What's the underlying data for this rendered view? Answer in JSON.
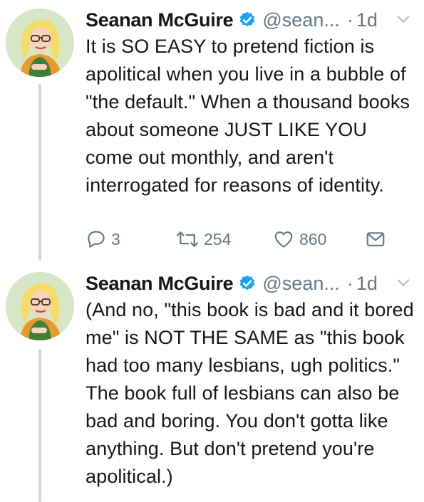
{
  "tweets": [
    {
      "author_name": "Seanan McGuire",
      "handle": "@sean...",
      "dot": "·",
      "time": "1d",
      "text": "It is SO EASY to pretend fiction is apolitical when you live in a bubble of \"the default.\" When a thousand books about someone JUST LIKE YOU come out monthly, and aren't interrogated for reasons of identity.",
      "replies": "3",
      "retweets": "254",
      "likes": "860"
    },
    {
      "author_name": "Seanan McGuire",
      "handle": "@sean...",
      "dot": "·",
      "time": "1d",
      "text": "(And no, \"this book is bad and it bored me\" is NOT THE SAME as \"this book had too many lesbians, ugh politics.\" The book full of lesbians can also be bad and boring. You don't gotta like anything. But don't pretend you're apolitical.)"
    }
  ],
  "icons": {
    "verified": "verified-badge-icon",
    "caret": "chevron-down-icon",
    "reply": "reply-icon",
    "retweet": "retweet-icon",
    "like": "heart-icon",
    "dm": "envelope-icon"
  },
  "colors": {
    "verified_blue": "#1da1f2",
    "secondary_text": "#657786",
    "thread_line": "#ccd6dd"
  }
}
